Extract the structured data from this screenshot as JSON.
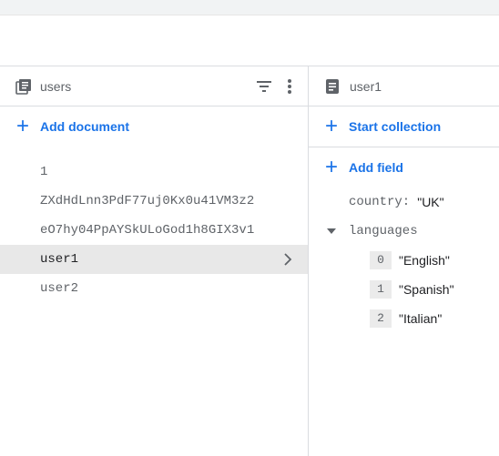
{
  "left_panel": {
    "title": "users",
    "add_label": "Add document",
    "documents": [
      "1",
      "ZXdHdLnn3PdF77uj0Kx0u41VM3z2",
      "eO7hy04PpAYSkULoGod1h8GIX3v1",
      "user1",
      "user2"
    ],
    "selected_document": "user1"
  },
  "right_panel": {
    "title": "user1",
    "start_collection_label": "Start collection",
    "add_field_label": "Add field",
    "fields": {
      "country": {
        "key": "country:",
        "value": "\"UK\""
      },
      "languages": {
        "key": "languages",
        "items": [
          {
            "index": "0",
            "value": "\"English\""
          },
          {
            "index": "1",
            "value": "\"Spanish\""
          },
          {
            "index": "2",
            "value": "\"Italian\""
          }
        ]
      }
    }
  },
  "icons": {
    "collection": "collection-icon",
    "filter": "filter-icon",
    "more": "more-vert-icon",
    "document": "document-icon",
    "add": "plus-icon",
    "chevron": "chevron-right-icon",
    "expand": "triangle-down-icon"
  },
  "colors": {
    "accent": "#1a73e8",
    "selected_row": "#e8e8e8",
    "divider": "#dadce0",
    "muted_text": "#5f6368"
  }
}
